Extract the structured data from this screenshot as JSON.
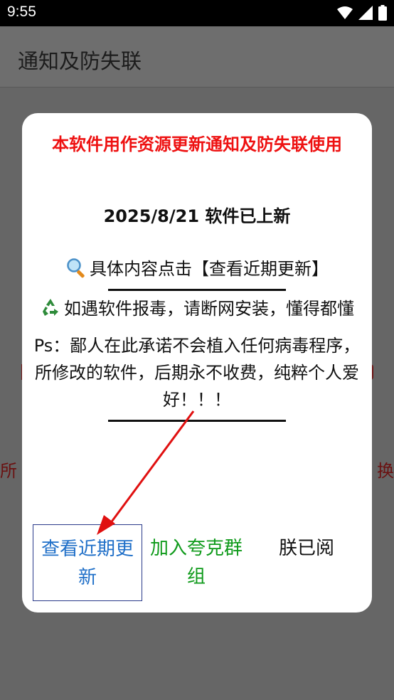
{
  "status_bar": {
    "time": "9:55"
  },
  "app_bar": {
    "title": "通知及防失联"
  },
  "background": {
    "left_text": "所",
    "right_text": "换"
  },
  "dialog": {
    "title": "本软件用作资源更新通知及防失联使用",
    "date_line": "2025/8/21 软件已上新",
    "line1": "具体内容点击【查看近期更新】",
    "line2": "如遇软件报毒，请断网安装，懂得都懂",
    "line3": "Ps：鄙人在此承诺不会植入任何病毒程序，所修改的软件，后期永不收费，纯粹个人爱好！！！",
    "buttons": {
      "recent": "查看近期更新",
      "quark": "加入夸克群组",
      "read": "朕已阅"
    }
  },
  "colors": {
    "title_red": "#ee1111",
    "link_blue": "#1f6fc8",
    "green": "#0e9a1a",
    "arrow_red": "#e01010"
  },
  "icons": [
    "magnifier-icon",
    "recycle-icon",
    "wifi-icon",
    "signal-icon",
    "battery-icon"
  ]
}
